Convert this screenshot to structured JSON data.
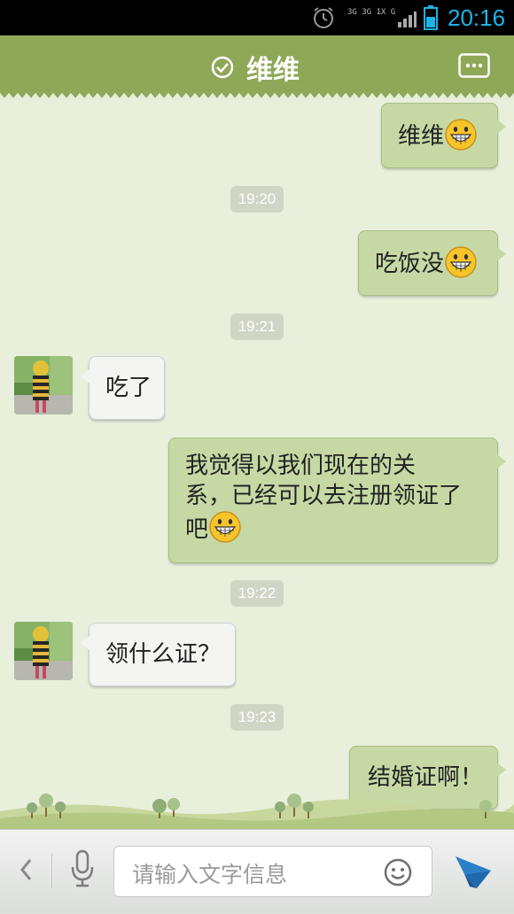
{
  "status_bar": {
    "network_line1": "3G 3G 1X G",
    "time": "20:16"
  },
  "header": {
    "title": "维维"
  },
  "messages": [
    {
      "type": "out",
      "text": "维维",
      "emoji": "grin-emoji"
    },
    {
      "type": "time",
      "text": "19:20"
    },
    {
      "type": "out",
      "text": "吃饭没",
      "emoji": "grin-emoji"
    },
    {
      "type": "time",
      "text": "19:21"
    },
    {
      "type": "in",
      "text": "吃了"
    },
    {
      "type": "out",
      "text_line1": "我觉得以我们现在的关",
      "text_line2": "系，已经可以去注册领证了",
      "text_line3": "吧",
      "emoji": "grin-emoji"
    },
    {
      "type": "time",
      "text": "19:22"
    },
    {
      "type": "in",
      "text": "领什么证？"
    },
    {
      "type": "time",
      "text": "19:23"
    },
    {
      "type": "out",
      "text": "结婚证啊！"
    }
  ],
  "input": {
    "placeholder": "请输入文字信息"
  },
  "colors": {
    "header_green": "#8ea857",
    "outgoing_bubble": "#c6d9a4",
    "incoming_bubble": "#f4f4f2",
    "time_blue": "#1fb3e6",
    "send_blue": "#2a7fc9"
  }
}
